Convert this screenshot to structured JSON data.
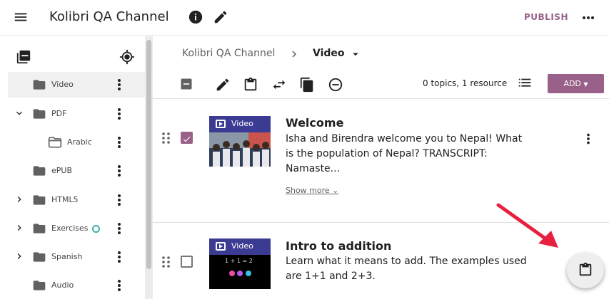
{
  "app": {
    "title": "Kolibri QA Channel",
    "publish_label": "PUBLISH"
  },
  "sidebar": {
    "items": [
      {
        "label": "Video",
        "expandable": false,
        "selected": true
      },
      {
        "label": "PDF",
        "expandable": true,
        "expanded": true
      },
      {
        "label": "Arabic",
        "expandable": false,
        "child": true
      },
      {
        "label": "ePUB",
        "expandable": false
      },
      {
        "label": "HTML5",
        "expandable": true
      },
      {
        "label": "Exercises",
        "expandable": true,
        "status": "in-progress"
      },
      {
        "label": "Spanish",
        "expandable": true
      },
      {
        "label": "Audio",
        "expandable": false
      }
    ]
  },
  "breadcrumb": {
    "parent": "Kolibri QA Channel",
    "current": "Video"
  },
  "toolbar": {
    "count_text": "0 topics, 1 resource",
    "add_label": "ADD"
  },
  "items": [
    {
      "kind_label": "Video",
      "title": "Welcome",
      "description": "Isha and Birendra welcome you to Nepal! What is the population of Nepal? TRANSCRIPT: Namaste...",
      "checked": true,
      "show_more": "Show more"
    },
    {
      "kind_label": "Video",
      "title": "Intro to addition",
      "description": "Learn what it means to add. The examples used are 1+1 and 2+3.",
      "checked": false,
      "thumb_text": "1 + 1 = 2"
    }
  ],
  "colors": {
    "accent": "#996189",
    "thumb_header": "#3c3b93",
    "annotation_arrow": "#e8203f",
    "status_ring": "#3ab2a6"
  }
}
